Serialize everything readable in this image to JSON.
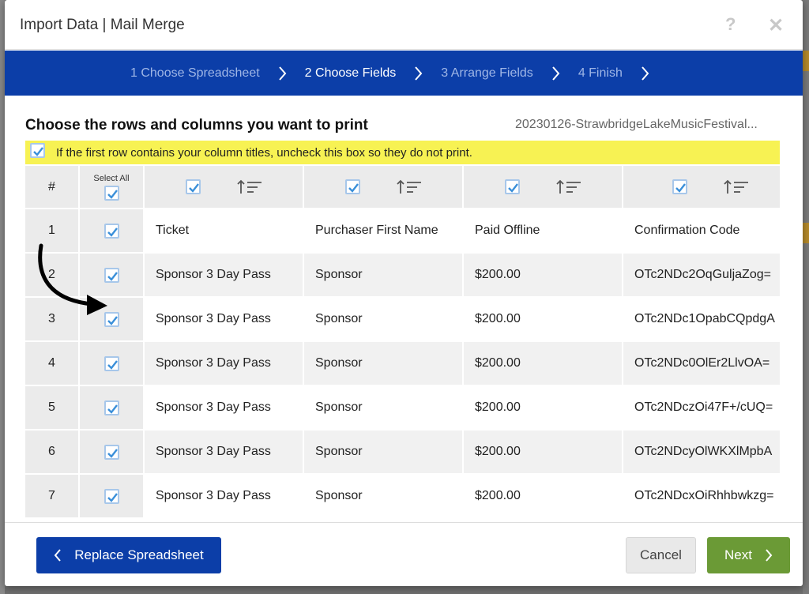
{
  "window": {
    "title": "Import Data | Mail Merge",
    "help_icon": "?",
    "close_icon": "✕"
  },
  "steps": [
    {
      "label": "1 Choose Spreadsheet",
      "active": false
    },
    {
      "label": "2 Choose Fields",
      "active": true
    },
    {
      "label": "3 Arrange Fields",
      "active": false
    },
    {
      "label": "4 Finish",
      "active": false
    }
  ],
  "content": {
    "heading": "Choose the rows and columns you want to print",
    "filename": "20230126-StrawbridgeLakeMusicFestival...",
    "notice": {
      "checked": true,
      "text": "If the first row contains your column titles, uncheck this box so they do not print."
    }
  },
  "table": {
    "num_header": "#",
    "select_all_label": "Select All",
    "select_all_checked": true,
    "columns": [
      {
        "checked": true,
        "sort_icon": "sort-icon"
      },
      {
        "checked": true,
        "sort_icon": "sort-icon"
      },
      {
        "checked": true,
        "sort_icon": "sort-icon"
      },
      {
        "checked": true,
        "sort_icon": "sort-icon"
      }
    ],
    "rows": [
      {
        "num": "1",
        "checked": true,
        "cells": [
          "Ticket",
          "Purchaser First Name",
          "Paid Offline",
          "Confirmation Code"
        ]
      },
      {
        "num": "2",
        "checked": true,
        "cells": [
          "Sponsor 3 Day Pass",
          "Sponsor",
          "$200.00",
          "OTc2NDc2OqGuljaZog="
        ]
      },
      {
        "num": "3",
        "checked": true,
        "cells": [
          "Sponsor 3 Day Pass",
          "Sponsor",
          "$200.00",
          "OTc2NDc1OpabCQpdgA"
        ]
      },
      {
        "num": "4",
        "checked": true,
        "cells": [
          "Sponsor 3 Day Pass",
          "Sponsor",
          "$200.00",
          "OTc2NDc0OlEr2LlvOA="
        ]
      },
      {
        "num": "5",
        "checked": true,
        "cells": [
          "Sponsor 3 Day Pass",
          "Sponsor",
          "$200.00",
          "OTc2NDczOi47F+/cUQ="
        ]
      },
      {
        "num": "6",
        "checked": true,
        "cells": [
          "Sponsor 3 Day Pass",
          "Sponsor",
          "$200.00",
          "OTc2NDcyOlWKXlMpbA"
        ]
      },
      {
        "num": "7",
        "checked": true,
        "cells": [
          "Sponsor 3 Day Pass",
          "Sponsor",
          "$200.00",
          "OTc2NDcxOiRhhbwkzg="
        ]
      }
    ]
  },
  "footer": {
    "replace_label": "Replace Spreadsheet",
    "cancel_label": "Cancel",
    "next_label": "Next"
  },
  "colors": {
    "primary": "#0c3ea8",
    "notice": "#f7f253",
    "next": "#6b9a36",
    "check": "#3a8fd9"
  }
}
